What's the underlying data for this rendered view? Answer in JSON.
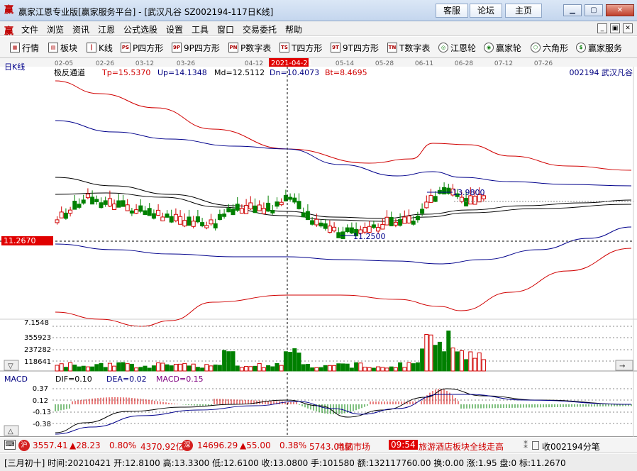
{
  "window": {
    "app_title": "赢家江恩专业版[赢家服务平台] - [武汉凡谷  SZ002194-117日K线]",
    "btn_service": "客服",
    "btn_forum": "论坛",
    "btn_home": "主页"
  },
  "menu": [
    "文件",
    "浏览",
    "资讯",
    "江恩",
    "公式选股",
    "设置",
    "工具",
    "窗口",
    "交易委托",
    "帮助"
  ],
  "toolbar": [
    "行情",
    "板块",
    "K线",
    "P四方形",
    "9P四方形",
    "P数字表",
    "T四方形",
    "9T四方形",
    "T数字表",
    "江恩轮",
    "赢家轮",
    "六角形",
    "赢家服务"
  ],
  "toolbar_icons": [
    "grid-icon",
    "blocks-icon",
    "kline-icon",
    "ps-icon",
    "9p-icon",
    "pn-icon",
    "ts-icon",
    "9t-icon",
    "tn-icon",
    "gann-wheel-icon",
    "winner-wheel-icon",
    "hexagon-icon",
    "dollar-icon"
  ],
  "chart": {
    "period_label": "日K线",
    "indicator_name": "极反通道",
    "indicator_values": [
      "Tp=15.5370",
      "Up=14.1348",
      "Md=12.5112",
      "Dn=10.4073",
      "Bt=8.4695"
    ],
    "stock_label": "002194  武汉凡谷",
    "date_ticks": [
      "02-05",
      "02-26",
      "03-12",
      "03-26",
      "04-12",
      "2021-04-21",
      "05-14",
      "05-28",
      "06-11",
      "06-28",
      "07-12",
      "07-26"
    ],
    "cursor_date": "2021-04-21",
    "price_cursor": "11.2670",
    "high_marker": "13.9800",
    "low_marker": "11.2500",
    "volume_labels": [
      "7.1548",
      "355923",
      "237282",
      "118641"
    ],
    "macd_title": "MACD",
    "macd_values": [
      "DIF=0.10",
      "DEA=0.02",
      "MACD=0.15"
    ],
    "macd_ticks": [
      "0.37",
      "0.12",
      "-0.13",
      "-0.38"
    ],
    "colors": {
      "upper_band": "#d00000",
      "channel": "#00008b",
      "mid": "#000000",
      "up_candle": "#d00000",
      "down_candle": "#008000"
    }
  },
  "status": {
    "sh_icon": "沪",
    "sh_index": "3557.41",
    "sh_change": "▲28.23",
    "sh_pct": "0.80%",
    "sh_amount": "4370.92亿",
    "sz_icon": "深",
    "sz_index": "14696.29",
    "sz_change": "▲55.00",
    "sz_pct": "0.38%",
    "sz_amount": "5743.04亿",
    "market": "电脑市场",
    "time": "09:54",
    "news": "旅游酒店板块全线走高",
    "close_label": "收002194分笔"
  },
  "status2": {
    "text": "[三月初十] 时间:20210421 开:12.8100 高:13.3300 低:12.6100 收:13.0800 手:101580 额:132117760.00 换:0.00 涨:1.95 盘:0 标:11.2670"
  }
}
